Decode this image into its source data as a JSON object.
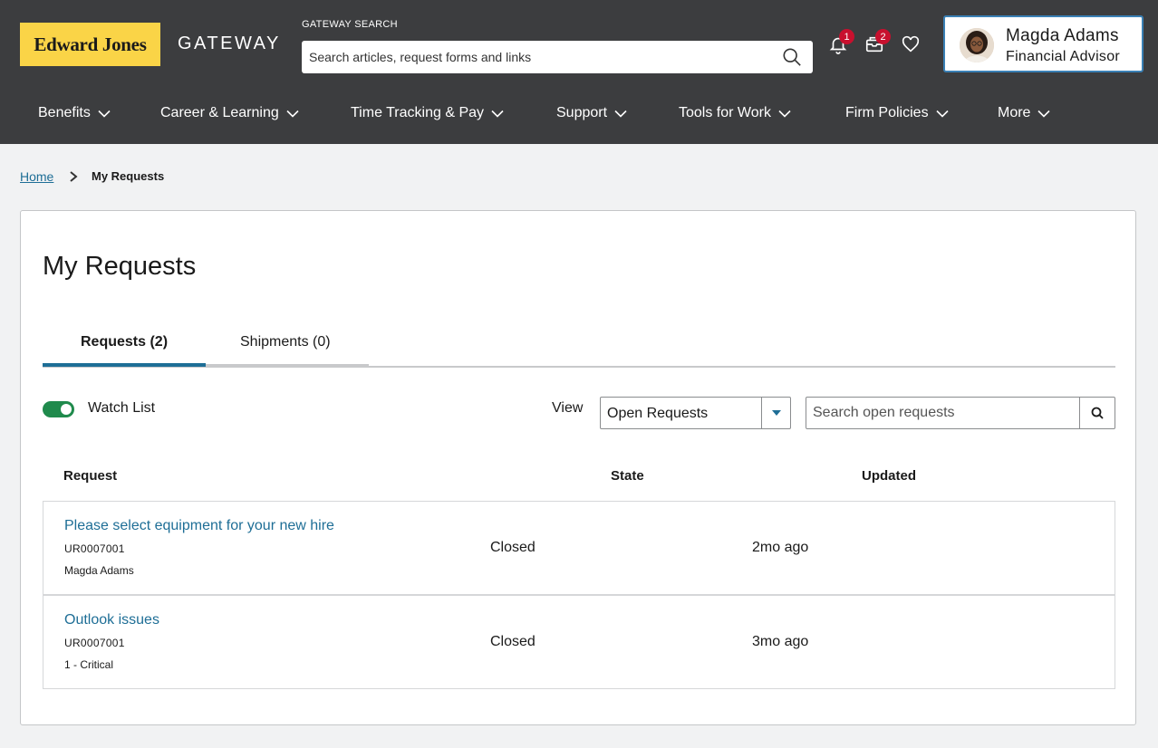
{
  "header": {
    "logo_text": "Edward Jones",
    "app_name": "GATEWAY",
    "search_label": "GATEWAY SEARCH",
    "search_placeholder": "Search articles, request forms and links",
    "notifications_count": "1",
    "inbox_count": "2",
    "profile": {
      "name": "Magda Adams",
      "role": "Financial Advisor"
    }
  },
  "nav": [
    {
      "label": "Benefits"
    },
    {
      "label": "Career & Learning"
    },
    {
      "label": "Time Tracking & Pay"
    },
    {
      "label": "Support"
    },
    {
      "label": "Tools for Work"
    },
    {
      "label": "Firm Policies"
    },
    {
      "label": "More"
    }
  ],
  "breadcrumb": {
    "home": "Home",
    "current": "My Requests"
  },
  "page": {
    "title": "My Requests",
    "tabs": [
      {
        "label": "Requests (2)",
        "active": true
      },
      {
        "label": "Shipments (0)",
        "active": false
      }
    ],
    "watch_list_label": "Watch List",
    "watch_list_on": true,
    "view_label": "View",
    "view_selected": "Open Requests",
    "search_placeholder": "Search open requests",
    "columns": [
      "Request",
      "State",
      "Updated"
    ],
    "rows": [
      {
        "title": "Please select equipment for your new hire",
        "id": "UR0007001",
        "meta": "Magda Adams",
        "state": "Closed",
        "updated": "2mo ago"
      },
      {
        "title": "Outlook issues",
        "id": "UR0007001",
        "meta": "1 - Critical",
        "state": "Closed",
        "updated": "3mo ago"
      }
    ]
  },
  "colors": {
    "header_bg": "#3c3d3f",
    "logo_yellow": "#fad447",
    "link_blue": "#1e6e96",
    "tab_accent": "#1e6e96",
    "toggle_green": "#1f8a4c",
    "badge_red": "#c8102e"
  },
  "icons": [
    "search-icon",
    "bell-icon",
    "inbox-icon",
    "heart-icon",
    "chevron-down-icon",
    "chevron-right-icon"
  ]
}
